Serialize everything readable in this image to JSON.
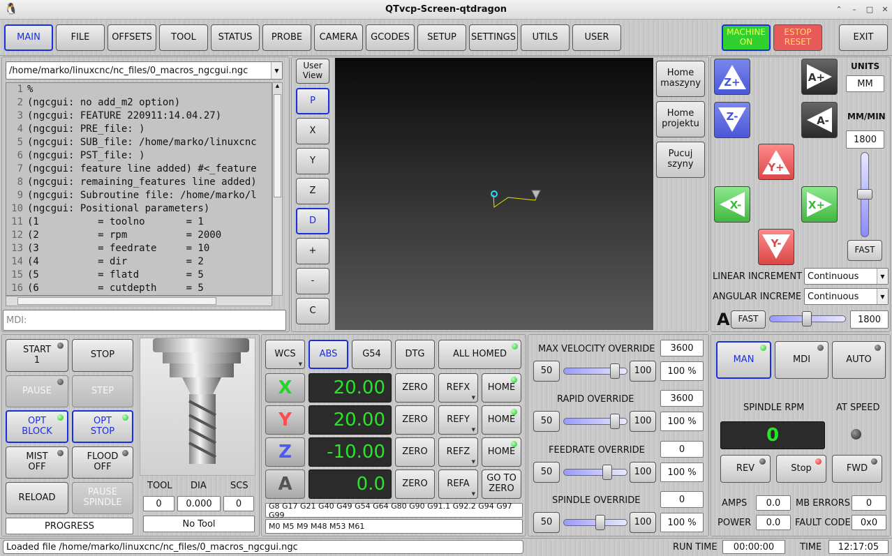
{
  "window": {
    "title": "QTvcp-Screen-qtdragon"
  },
  "tabs": [
    "MAIN",
    "FILE",
    "OFFSETS",
    "TOOL",
    "STATUS",
    "PROBE",
    "CAMERA",
    "GCODES",
    "SETUP",
    "SETTINGS",
    "UTILS",
    "USER"
  ],
  "header": {
    "machine_on": "MACHINE\nON",
    "estop": "ESTOP\nRESET",
    "exit": "EXIT"
  },
  "file": {
    "path": "/home/marko/linuxcnc/nc_files/0_macros_ngcgui.ngc",
    "mdi_placeholder": "MDI:"
  },
  "code_lines": [
    "%",
    "(ngcgui: no add_m2 option)",
    "(ngcgui: FEATURE 220911:14.04.27)",
    "(ngcgui: PRE_file: )",
    "(ngcgui: SUB_file: /home/marko/linuxcnc",
    "(ngcgui: PST_file: )",
    "(ngcgui: feature line added) #<_feature",
    "(ngcgui: remaining_features line added)",
    "(ngcgui: Subroutine file: /home/marko/l",
    "(ngcgui: Positional parameters)",
    "(1          = toolno       = 1",
    "(2          = rpm          = 2000",
    "(3          = feedrate     = 10",
    "(4          = dir          = 2",
    "(5          = flatd        = 5",
    "(6          = cutdepth     = 5"
  ],
  "view_buttons": {
    "user_view": "User\nView",
    "p": "P",
    "x": "X",
    "y": "Y",
    "z": "Z",
    "d": "D",
    "plus": "+",
    "minus": "-",
    "c": "C"
  },
  "macro_buttons": [
    "Home\nmaszyny",
    "Home\nprojektu",
    "Pucuj\nszyny"
  ],
  "jog": {
    "z_plus": "Z+",
    "z_minus": "Z-",
    "a_plus": "A+",
    "a_minus": "A-",
    "y_plus": "Y+",
    "y_minus": "Y-",
    "x_plus": "X+",
    "x_minus": "X-",
    "units_label": "UNITS",
    "units_value": "MM",
    "rate_label": "MM/MIN",
    "rate_value": "1800",
    "fast": "FAST",
    "linear_label": "LINEAR INCREMENT",
    "linear_value": "Continuous",
    "angular_label": "ANGULAR INCREMENT",
    "angular_value": "Continuous",
    "a_label": "A",
    "a_fast": "FAST",
    "a_rate": "1800"
  },
  "program": {
    "start": "START\n1",
    "stop": "STOP",
    "pause": "PAUSE",
    "step": "STEP",
    "opt_block": "OPT\nBLOCK",
    "opt_stop": "OPT\nSTOP",
    "mist": "MIST\nOFF",
    "flood": "FLOOD\nOFF",
    "reload": "RELOAD",
    "pause_spindle": "PAUSE\nSPINDLE",
    "progress": "PROGRESS"
  },
  "tool": {
    "tool_label": "TOOL",
    "dia_label": "DIA",
    "scs_label": "SCS",
    "tool_value": "0",
    "dia_value": "0.000",
    "scs_value": "0",
    "name": "No Tool"
  },
  "dro": {
    "wcs": "WCS",
    "abs": "ABS",
    "g54": "G54",
    "dtg": "DTG",
    "all_homed": "ALL HOMED",
    "axes": [
      {
        "name": "X",
        "color": "#27d327",
        "value": "20.00",
        "ref": "REFX",
        "home": "HOME"
      },
      {
        "name": "Y",
        "color": "#ff4c4c",
        "value": "20.00",
        "ref": "REFY",
        "home": "HOME"
      },
      {
        "name": "Z",
        "color": "#4a5cf0",
        "value": "-10.00",
        "ref": "REFZ",
        "home": "HOME"
      },
      {
        "name": "A",
        "color": "#555555",
        "value": "0.0",
        "ref": "REFA",
        "home": "GO TO\nZERO"
      }
    ],
    "zero": "ZERO",
    "gcodes": "G8 G17 G21 G40 G49 G54 G64 G80 G90 G91.1 G92.2 G94 G97 G99",
    "mcodes": "M0 M5 M9 M48 M53 M61"
  },
  "overrides": [
    {
      "label": "MAX VELOCITY OVERRIDE",
      "value": "3600",
      "low": "50",
      "high": "100",
      "percent": "100 %",
      "level": 0.85
    },
    {
      "label": "RAPID OVERRIDE",
      "value": "3600",
      "low": "50",
      "high": "100",
      "percent": "100 %",
      "level": 0.84
    },
    {
      "label": "FEEDRATE OVERRIDE",
      "value": "0",
      "low": "50",
      "high": "100",
      "percent": "100 %",
      "level": 0.7
    },
    {
      "label": "SPINDLE OVERRIDE",
      "value": "0",
      "low": "50",
      "high": "100",
      "percent": "100 %",
      "level": 0.58
    }
  ],
  "mode": {
    "man": "MAN",
    "mdi": "MDI",
    "auto": "AUTO"
  },
  "spindle": {
    "rpm_label": "SPINDLE RPM",
    "at_speed_label": "AT SPEED",
    "rpm": "0",
    "rev": "REV",
    "stop": "Stop",
    "fwd": "FWD",
    "amps_label": "AMPS",
    "amps": "0.0",
    "mb_label": "MB ERRORS",
    "mb": "0",
    "power_label": "POWER",
    "power": "0.0",
    "fault_label": "FAULT CODE",
    "fault": "0x0"
  },
  "status": {
    "message": "Loaded file /home/marko/linuxcnc/nc_files/0_macros_ngcgui.ngc",
    "runtime_label": "RUN TIME",
    "runtime": "00:00:00",
    "time_label": "TIME",
    "time": "12:17:05"
  },
  "colors": {
    "selected": "#1a2ee0",
    "machine_on": "#2fd02f",
    "estop": "#e85a5a",
    "dro_text": "#27e627"
  }
}
